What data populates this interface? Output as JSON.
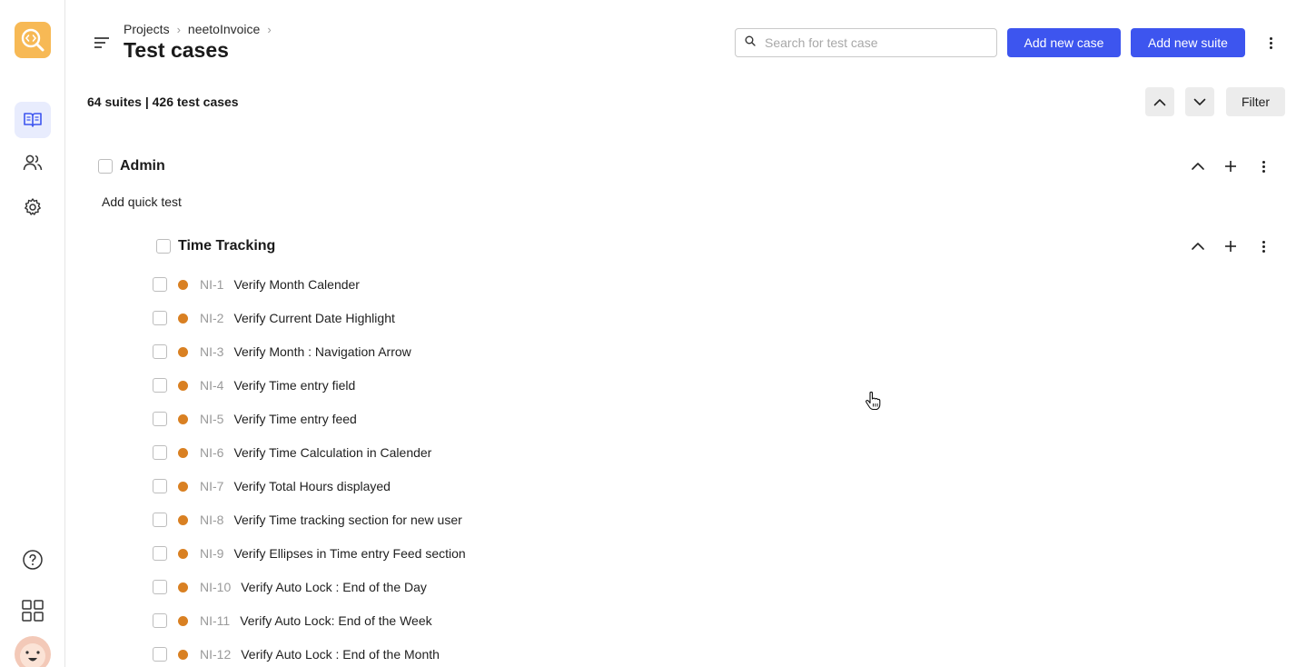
{
  "header": {
    "breadcrumb": [
      "Projects",
      "neetoInvoice"
    ],
    "title": "Test cases",
    "search_placeholder": "Search for test case",
    "add_case_label": "Add new case",
    "add_suite_label": "Add new suite"
  },
  "summary": {
    "counts": "64 suites | 426 test cases",
    "filter_label": "Filter"
  },
  "suites": [
    {
      "name": "Admin",
      "quick_test_label": "Add quick test"
    },
    {
      "name": "Time Tracking"
    }
  ],
  "test_cases": [
    {
      "id": "NI-1",
      "name": "Verify Month Calender"
    },
    {
      "id": "NI-2",
      "name": "Verify Current Date Highlight"
    },
    {
      "id": "NI-3",
      "name": "Verify Month : Navigation Arrow"
    },
    {
      "id": "NI-4",
      "name": "Verify Time entry field"
    },
    {
      "id": "NI-5",
      "name": "Verify Time entry feed"
    },
    {
      "id": "NI-6",
      "name": "Verify Time Calculation in Calender"
    },
    {
      "id": "NI-7",
      "name": "Verify Total Hours displayed"
    },
    {
      "id": "NI-8",
      "name": "Verify Time tracking section for new user"
    },
    {
      "id": "NI-9",
      "name": "Verify Ellipses in Time entry Feed section"
    },
    {
      "id": "NI-10",
      "name": "Verify Auto Lock : End of the Day"
    },
    {
      "id": "NI-11",
      "name": "Verify Auto Lock: End of the Week"
    },
    {
      "id": "NI-12",
      "name": "Verify Auto Lock : End of the Month"
    }
  ],
  "colors": {
    "primary": "#3d55ef",
    "status_dot": "#d98022",
    "logo": "#f7b955",
    "active_nav": "#e8ecfd"
  },
  "icons": {
    "sidebar": [
      "logo-icon",
      "book-icon",
      "users-icon",
      "gear-icon",
      "help-icon",
      "apps-grid-icon",
      "avatar"
    ],
    "header": [
      "menu-icon",
      "chevron-right-icon",
      "search-icon",
      "more-vertical-icon"
    ],
    "suite_actions": [
      "chevron-up-icon",
      "plus-icon",
      "more-vertical-icon"
    ]
  }
}
